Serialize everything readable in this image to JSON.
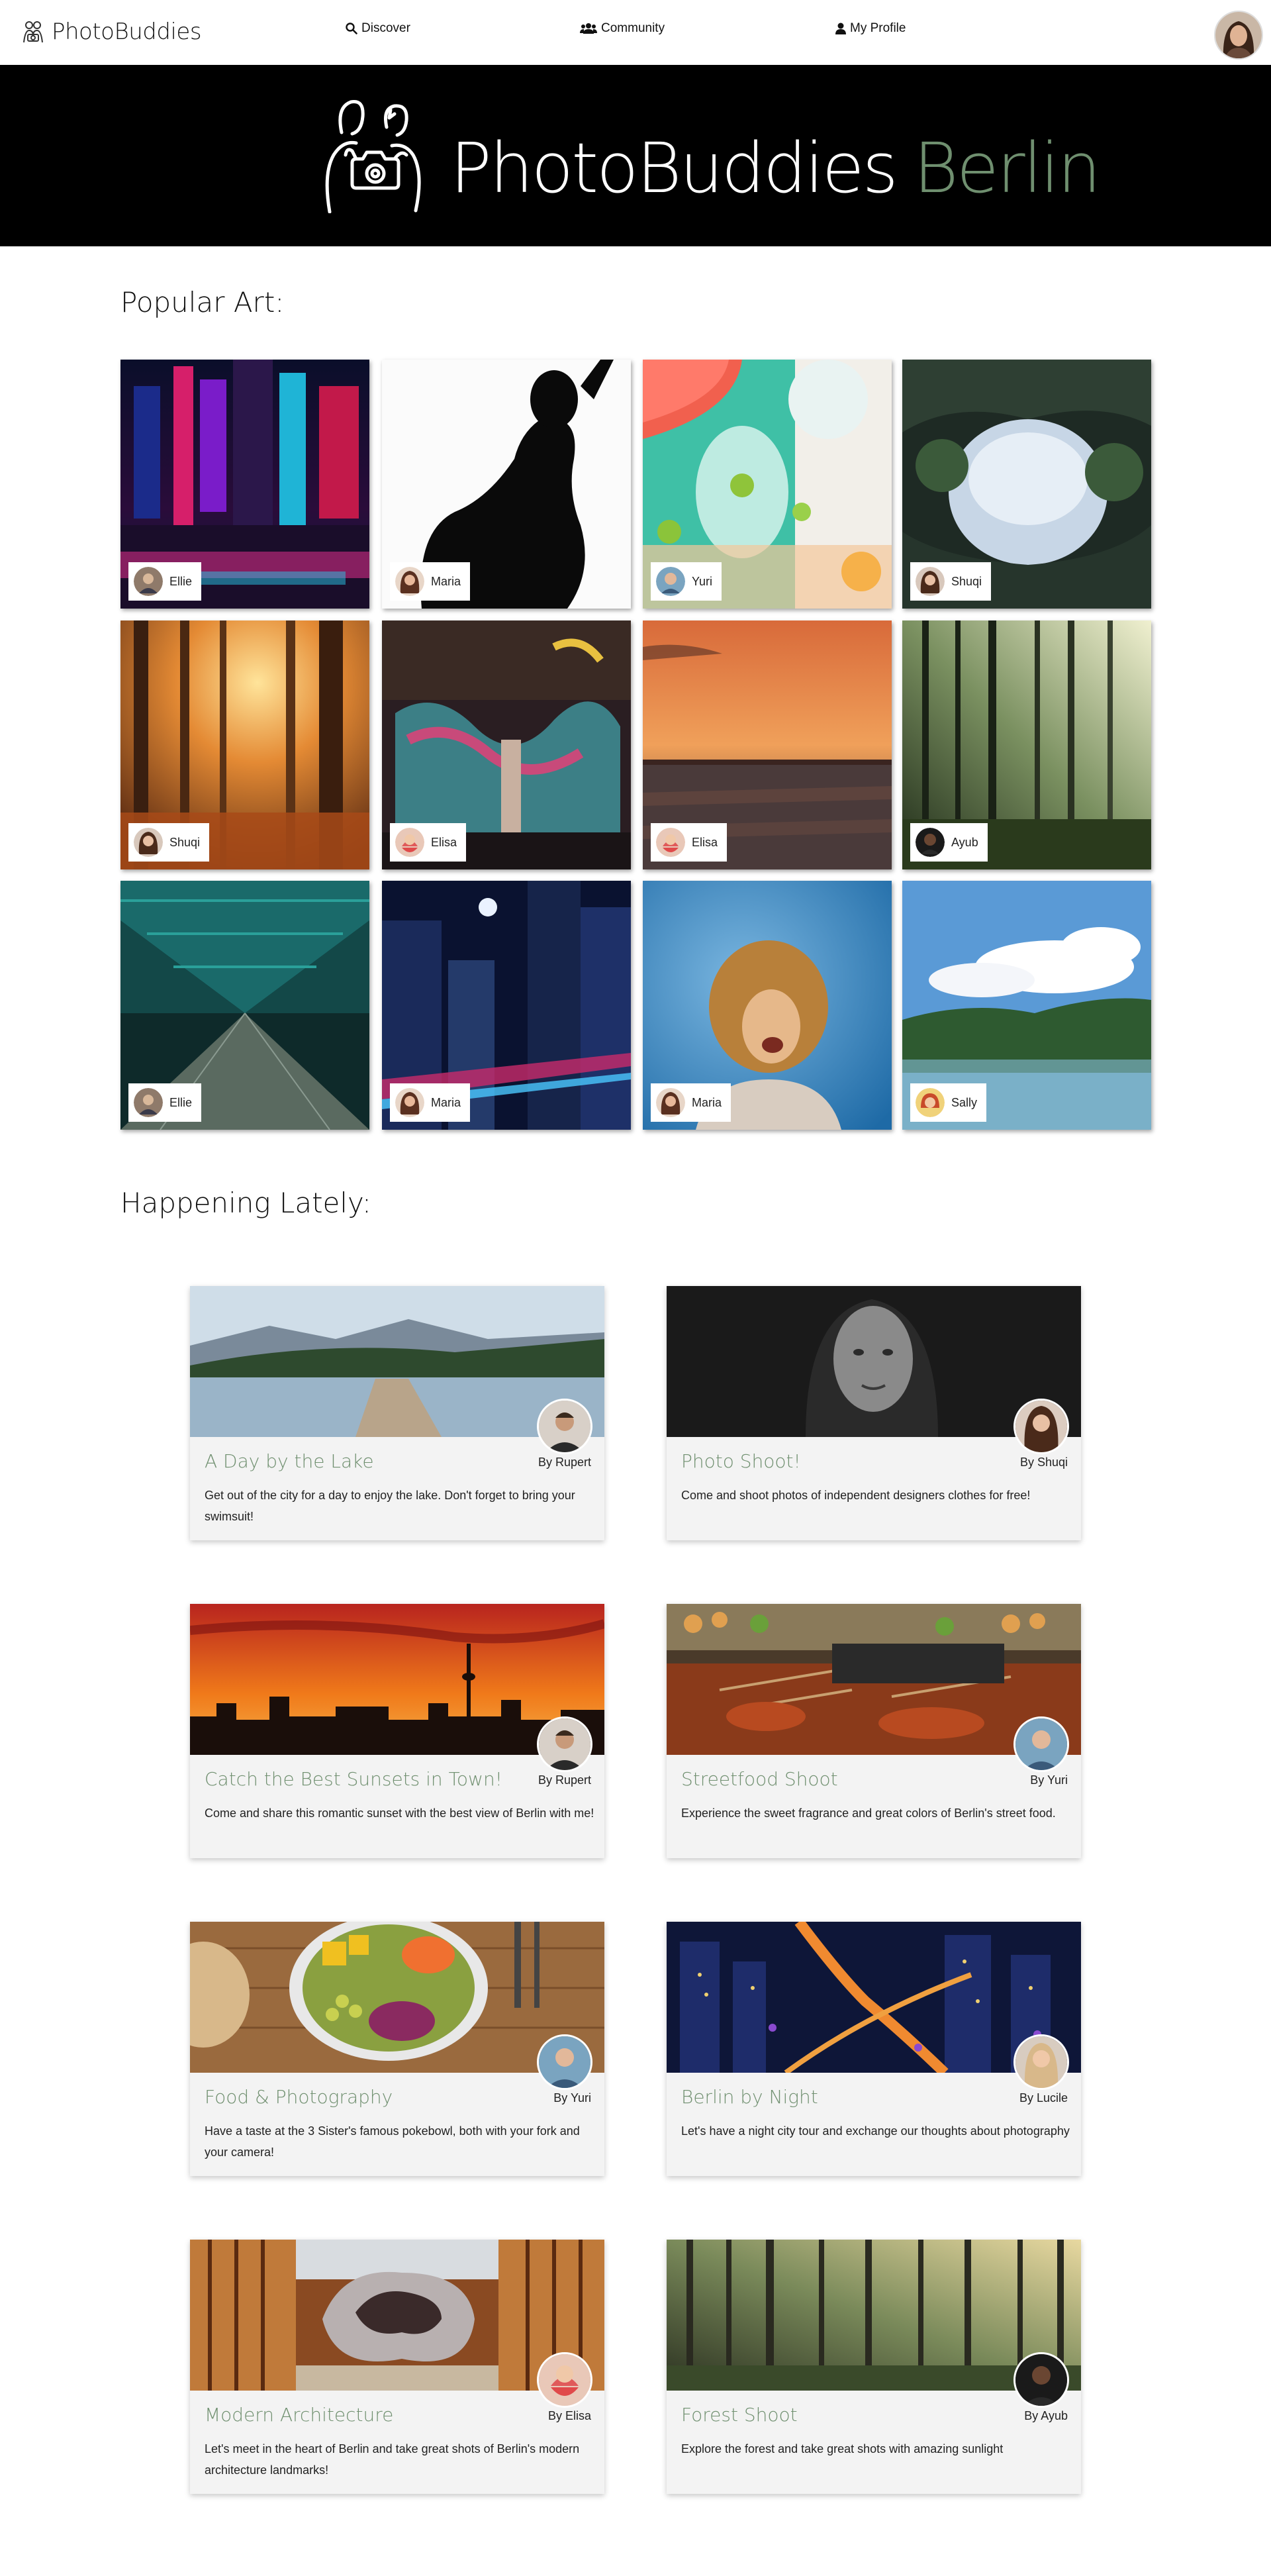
{
  "nav": {
    "brand": "PhotoBuddies",
    "links": [
      {
        "label": "Discover",
        "icon": "search-icon"
      },
      {
        "label": "Community",
        "icon": "users-icon"
      },
      {
        "label": "My Profile",
        "icon": "user-icon"
      }
    ]
  },
  "banner": {
    "title": "PhotoBuddies",
    "city": "Berlin"
  },
  "colors": {
    "accent": "#6f8f6f",
    "banner_bg": "#000000"
  },
  "popular": {
    "title": "Popular Art:",
    "items": [
      {
        "author": "Ellie"
      },
      {
        "author": "Maria"
      },
      {
        "author": "Yuri"
      },
      {
        "author": "Shuqi"
      },
      {
        "author": "Shuqi"
      },
      {
        "author": "Elisa"
      },
      {
        "author": "Elisa"
      },
      {
        "author": "Ayub"
      },
      {
        "author": "Ellie"
      },
      {
        "author": "Maria"
      },
      {
        "author": "Maria"
      },
      {
        "author": "Sally"
      }
    ]
  },
  "events": {
    "title": "Happening Lately:",
    "items": [
      {
        "title": "A Day by the Lake",
        "by": "By Rupert",
        "desc": "Get out of the city for a day to enjoy the lake. Don't forget to bring your swimsuit!"
      },
      {
        "title": "Photo Shoot!",
        "by": "By Shuqi",
        "desc": "Come and shoot photos of independent designers clothes for free!"
      },
      {
        "title": "Catch the Best Sunsets in Town!",
        "by": "By Rupert",
        "desc": "Come and share this romantic sunset with the best view of Berlin with me!"
      },
      {
        "title": "Streetfood Shoot",
        "by": "By Yuri",
        "desc": "Experience the sweet fragrance and great colors of Berlin's street food."
      },
      {
        "title": "Food & Photography",
        "by": "By Yuri",
        "desc": "Have a taste at the 3 Sister's famous pokebowl, both with your fork and your camera!"
      },
      {
        "title": "Berlin by Night",
        "by": "By Lucile",
        "desc": "Let's have a night city tour and exchange our thoughts about photography"
      },
      {
        "title": "Modern Architecture",
        "by": "By Elisa",
        "desc": "Let's meet in the heart of Berlin and take great shots of Berlin's modern architecture landmarks!"
      },
      {
        "title": "Forest Shoot",
        "by": "By Ayub",
        "desc": "Explore the forest and take great shots with amazing sunlight"
      }
    ]
  }
}
